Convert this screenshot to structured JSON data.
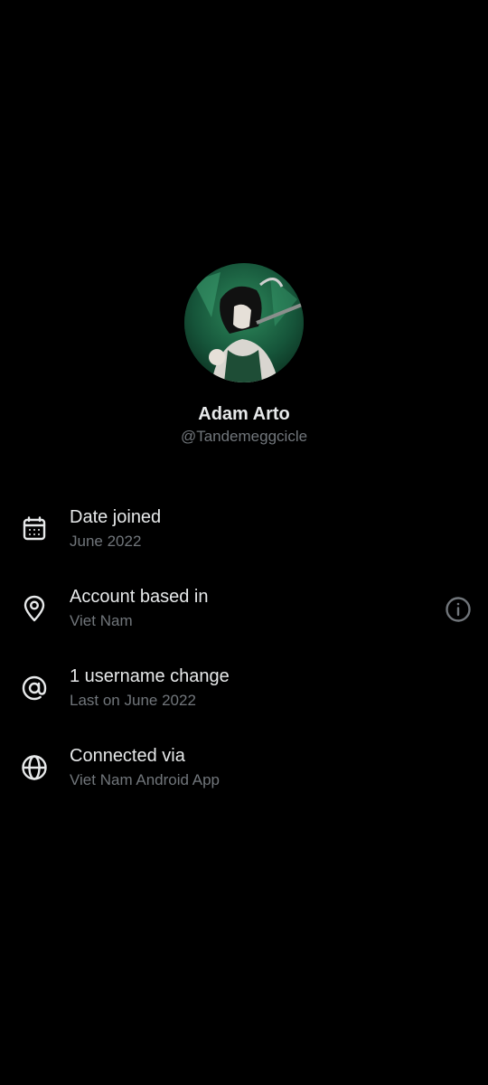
{
  "profile": {
    "display_name": "Adam Arto",
    "handle": "@Tandemeggcicle"
  },
  "about": {
    "items": [
      {
        "icon": "calendar-icon",
        "title": "Date joined",
        "subtitle": "June 2022"
      },
      {
        "icon": "location-pin-icon",
        "title": "Account based in",
        "subtitle": "Viet Nam"
      },
      {
        "icon": "at-sign-icon",
        "title": "1 username change",
        "subtitle": "Last on June 2022"
      },
      {
        "icon": "globe-icon",
        "title": "Connected via",
        "subtitle": "Viet Nam Android App"
      }
    ]
  },
  "colors": {
    "background": "#000000",
    "primary_text": "#e7e9ea",
    "secondary_text": "#71767b",
    "avatar_green": "#1f6b45"
  }
}
